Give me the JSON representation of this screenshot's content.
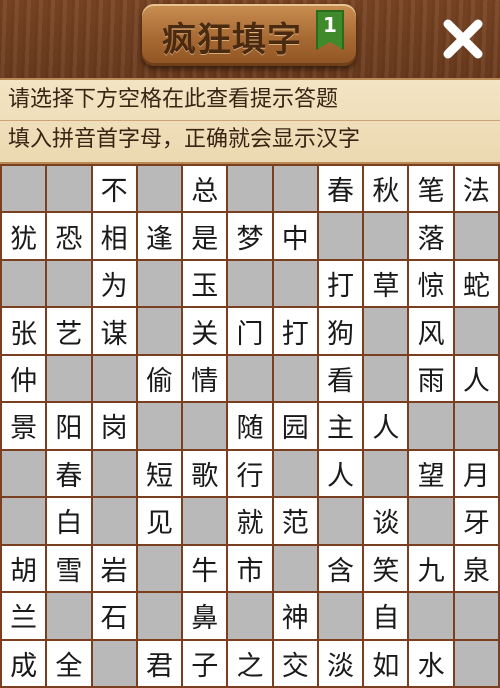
{
  "header": {
    "title": "疯狂填字",
    "level": "1",
    "close_icon": "close-icon"
  },
  "hints": {
    "line1": "请选择下方空格在此查看提示答题",
    "line2": "填入拼音首字母，正确就会显示汉字"
  },
  "colors": {
    "wood": "#6b3b1c",
    "empty_cell": "#b9b9b9",
    "filled_cell": "#ffffff",
    "badge": "#3f8a2a"
  },
  "grid": {
    "rows": [
      [
        "",
        "",
        "不",
        "",
        "总",
        "",
        "",
        "春",
        "秋",
        "笔",
        "法"
      ],
      [
        "犹",
        "恐",
        "相",
        "逢",
        "是",
        "梦",
        "中",
        "",
        "",
        "落",
        ""
      ],
      [
        "",
        "",
        "为",
        "",
        "玉",
        "",
        "",
        "打",
        "草",
        "惊",
        "蛇"
      ],
      [
        "张",
        "艺",
        "谋",
        "",
        "关",
        "门",
        "打",
        "狗",
        "",
        "风",
        ""
      ],
      [
        "仲",
        "",
        "",
        "偷",
        "情",
        "",
        "",
        "看",
        "",
        "雨",
        "人"
      ],
      [
        "景",
        "阳",
        "岗",
        "",
        "",
        "随",
        "园",
        "主",
        "人",
        "",
        ""
      ],
      [
        "",
        "春",
        "",
        "短",
        "歌",
        "行",
        "",
        "人",
        "",
        "望",
        "月"
      ],
      [
        "",
        "白",
        "",
        "见",
        "",
        "就",
        "范",
        "",
        "谈",
        "",
        "牙"
      ],
      [
        "胡",
        "雪",
        "岩",
        "",
        "牛",
        "市",
        "",
        "含",
        "笑",
        "九",
        "泉"
      ],
      [
        "兰",
        "",
        "石",
        "",
        "鼻",
        "",
        "神",
        "",
        "自",
        "",
        ""
      ],
      [
        "成",
        "全",
        "",
        "君",
        "子",
        "之",
        "交",
        "淡",
        "如",
        "水",
        ""
      ]
    ]
  }
}
